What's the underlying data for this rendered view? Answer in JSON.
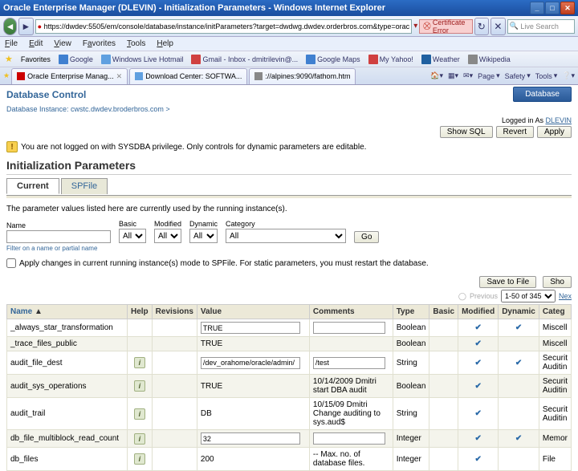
{
  "browser": {
    "window_title": "Oracle Enterprise Manager (DLEVIN) - Initialization Parameters - Windows Internet Explorer",
    "url": "https://dwdev:5505/em/console/database/instance/initParameters?target=dwdwg.dwdev.orderbros.com&type=orac",
    "cert_error": "Certificate Error",
    "search_placeholder": "Live Search",
    "menu": [
      "File",
      "Edit",
      "View",
      "Favorites",
      "Tools",
      "Help"
    ],
    "favorites_label": "Favorites",
    "bookmarks": [
      "Google",
      "Windows Live Hotmail",
      "Gmail - Inbox - dmitrilevin@...",
      "Google Maps",
      "My Yahoo!",
      "Weather",
      "Wikipedia"
    ],
    "tabs": [
      {
        "label": "Oracle Enterprise Manag...",
        "close": true
      },
      {
        "label": "Download Center: SOFTWA..."
      },
      {
        "label": "://alpines:9090/fathom.htm"
      }
    ],
    "toolbar": [
      "Page",
      "Safety",
      "Tools"
    ]
  },
  "page": {
    "app_title": "Database Control",
    "db_button": "Database",
    "breadcrumb": "Database Instance: cwstc.dwdev.broderbros.com  >",
    "logged_in_prefix": "Logged in As ",
    "logged_in_user": "DLEVIN",
    "buttons": {
      "show_sql": "Show SQL",
      "revert": "Revert",
      "apply": "Apply"
    },
    "warning": "You are not logged on with SYSDBA privilege. Only controls for dynamic parameters are editable.",
    "section_title": "Initialization Parameters",
    "subtabs": {
      "current": "Current",
      "spfile": "SPFile"
    },
    "desc": "The parameter values listed here are currently used by the running instance(s).",
    "filters": {
      "name_label": "Name",
      "basic_label": "Basic",
      "basic_val": "All",
      "modified_label": "Modified",
      "modified_val": "All",
      "dynamic_label": "Dynamic",
      "dynamic_val": "All",
      "category_label": "Category",
      "category_val": "All",
      "go": "Go"
    },
    "hint": "Filter on a name or partial name",
    "apply_checkbox": "Apply changes in current running instance(s) mode to SPFile. For static parameters, you must restart the database.",
    "save_to_file": "Save to File",
    "show_all": "Sho",
    "pager": {
      "previous_icon": "◯",
      "previous": "Previous",
      "range": "1-50 of 345",
      "next": "Nex"
    },
    "columns": {
      "name": "Name",
      "help": "Help",
      "revisions": "Revisions",
      "value": "Value",
      "comments": "Comments",
      "type": "Type",
      "basic": "Basic",
      "modified": "Modified",
      "dynamic": "Dynamic",
      "category": "Categ"
    },
    "rows": [
      {
        "name": "_always_star_transformation",
        "help": false,
        "rev": false,
        "value": "TRUE",
        "comments": "",
        "type": "Boolean",
        "basic": false,
        "modified": true,
        "dynamic": true,
        "category": "Miscell"
      },
      {
        "name": "_trace_files_public",
        "help": false,
        "rev": false,
        "value": "TRUE",
        "comments": "",
        "type": "Boolean",
        "basic": false,
        "modified": true,
        "dynamic": false,
        "category": "Miscell"
      },
      {
        "name": "audit_file_dest",
        "help": true,
        "rev": false,
        "value": "/dev_orahome/oracle/admin/",
        "comments": "/test",
        "type": "String",
        "basic": false,
        "modified": true,
        "dynamic": true,
        "category": "Securit Auditin"
      },
      {
        "name": "audit_sys_operations",
        "help": true,
        "rev": false,
        "value": "TRUE",
        "comments": "10/14/2009 Dmitri start DBA audit",
        "type": "Boolean",
        "basic": false,
        "modified": true,
        "dynamic": false,
        "category": "Securit Auditin"
      },
      {
        "name": "audit_trail",
        "help": true,
        "rev": false,
        "value": "DB",
        "comments": "10/15/09 Dmitri Change auditing to sys.aud$",
        "type": "String",
        "basic": false,
        "modified": true,
        "dynamic": false,
        "category": "Securit Auditin"
      },
      {
        "name": "db_file_multiblock_read_count",
        "help": true,
        "rev": false,
        "value": "32",
        "comments": "",
        "type": "Integer",
        "basic": false,
        "modified": true,
        "dynamic": true,
        "category": "Memor"
      },
      {
        "name": "db_files",
        "help": true,
        "rev": false,
        "value": "200",
        "comments": "-- Max. no. of database files.",
        "type": "Integer",
        "basic": false,
        "modified": true,
        "dynamic": false,
        "category": "File"
      }
    ]
  }
}
